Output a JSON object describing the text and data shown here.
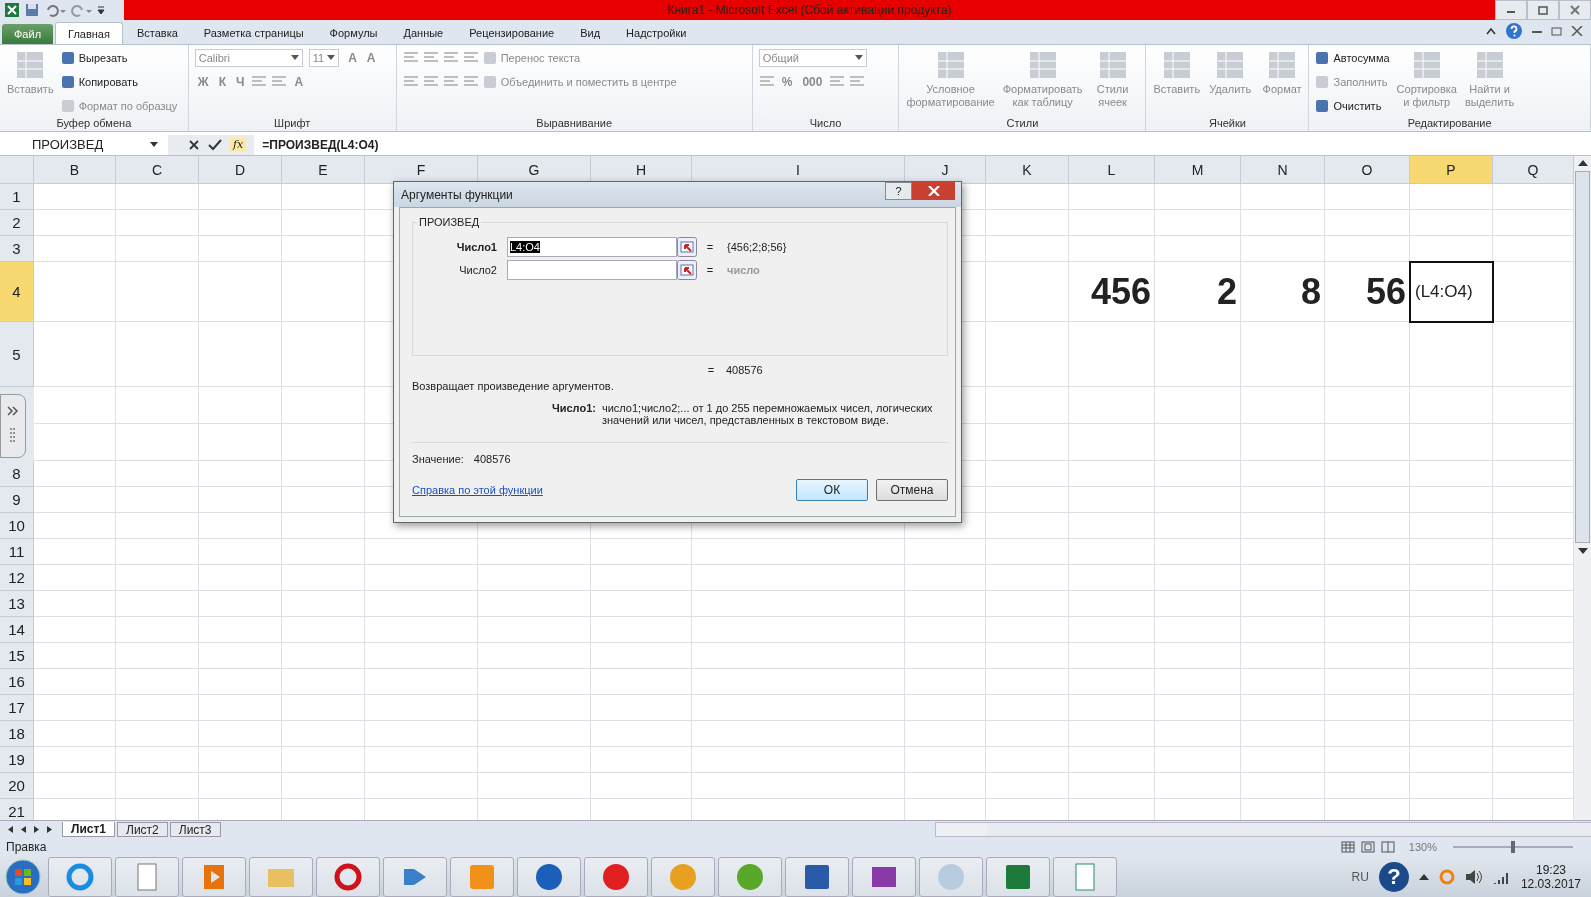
{
  "window": {
    "title": "Книга1  -  Microsoft Excel (Сбой активации продукта)"
  },
  "tabs": [
    {
      "label": "Файл",
      "kind": "file",
      "selected": false
    },
    {
      "label": "Главная",
      "kind": "tab",
      "selected": true
    },
    {
      "label": "Вставка",
      "kind": "tab",
      "selected": false
    },
    {
      "label": "Разметка страницы",
      "kind": "tab",
      "selected": false
    },
    {
      "label": "Формулы",
      "kind": "tab",
      "selected": false
    },
    {
      "label": "Данные",
      "kind": "tab",
      "selected": false
    },
    {
      "label": "Рецензирование",
      "kind": "tab",
      "selected": false
    },
    {
      "label": "Вид",
      "kind": "tab",
      "selected": false
    },
    {
      "label": "Надстройки",
      "kind": "tab",
      "selected": false
    }
  ],
  "ribbon": [
    {
      "label": "Буфер обмена",
      "parts": [
        {
          "kind": "large",
          "label": "Вставить",
          "disabled": true
        },
        {
          "kind": "stack",
          "lines": [
            [
              {
                "kind": "small",
                "label": "Вырезать",
                "disabled": false
              }
            ],
            [
              {
                "kind": "small",
                "label": "Копировать",
                "disabled": false
              }
            ],
            [
              {
                "kind": "small",
                "label": "Формат по образцу",
                "disabled": true
              }
            ]
          ]
        }
      ]
    },
    {
      "label": "Шрифт",
      "parts": [
        {
          "kind": "stack",
          "lines": [
            [
              {
                "kind": "field",
                "label": "Calibri",
                "disabled": true
              },
              {
                "kind": "field",
                "label": "11",
                "disabled": true
              },
              {
                "kind": "tool",
                "label": "A",
                "disabled": true
              },
              {
                "kind": "tool",
                "label": "A",
                "disabled": true
              }
            ],
            [
              {
                "kind": "tool",
                "label": "Ж",
                "disabled": true
              },
              {
                "kind": "tool",
                "label": "К",
                "disabled": true
              },
              {
                "kind": "tool",
                "label": "Ч",
                "disabled": true
              },
              {
                "kind": "icon",
                "disabled": true
              },
              {
                "kind": "icon",
                "disabled": true
              },
              {
                "kind": "tool",
                "label": "A",
                "disabled": true
              }
            ]
          ]
        }
      ]
    },
    {
      "label": "Выравнивание",
      "parts": [
        {
          "kind": "stack",
          "lines": [
            [
              {
                "kind": "icon",
                "disabled": true
              },
              {
                "kind": "icon",
                "disabled": true
              },
              {
                "kind": "icon",
                "disabled": true
              },
              {
                "kind": "icon",
                "disabled": true
              },
              {
                "kind": "small",
                "label": "Перенос текста",
                "disabled": true
              }
            ],
            [
              {
                "kind": "icon",
                "disabled": true
              },
              {
                "kind": "icon",
                "disabled": true
              },
              {
                "kind": "icon",
                "disabled": true
              },
              {
                "kind": "icon",
                "disabled": true
              },
              {
                "kind": "small",
                "label": "Объединить и поместить в центре",
                "disabled": true
              }
            ]
          ]
        }
      ]
    },
    {
      "label": "Число",
      "parts": [
        {
          "kind": "stack",
          "lines": [
            [
              {
                "kind": "field",
                "label": "Общий",
                "disabled": true
              }
            ],
            [
              {
                "kind": "icon",
                "disabled": true
              },
              {
                "kind": "tool",
                "label": "%",
                "disabled": true
              },
              {
                "kind": "tool",
                "label": "000",
                "disabled": true
              },
              {
                "kind": "icon",
                "disabled": true
              },
              {
                "kind": "icon",
                "disabled": true
              }
            ]
          ]
        }
      ]
    },
    {
      "label": "Стили",
      "parts": [
        {
          "kind": "large",
          "label": "Условное форматирование",
          "disabled": true
        },
        {
          "kind": "large",
          "label": "Форматировать как таблицу",
          "disabled": true
        },
        {
          "kind": "large",
          "label": "Стили ячеек",
          "disabled": true
        }
      ]
    },
    {
      "label": "Ячейки",
      "parts": [
        {
          "kind": "large",
          "label": "Вставить",
          "disabled": true
        },
        {
          "kind": "large",
          "label": "Удалить",
          "disabled": true
        },
        {
          "kind": "large",
          "label": "Формат",
          "disabled": true
        }
      ]
    },
    {
      "label": "Редактирование",
      "parts": [
        {
          "kind": "stack",
          "lines": [
            [
              {
                "kind": "small",
                "label": "Автосумма",
                "disabled": false
              }
            ],
            [
              {
                "kind": "small",
                "label": "Заполнить",
                "disabled": true
              }
            ],
            [
              {
                "kind": "small",
                "label": "Очистить",
                "disabled": false
              }
            ]
          ]
        },
        {
          "kind": "large",
          "label": "Сортировка и фильтр",
          "disabled": true
        },
        {
          "kind": "large",
          "label": "Найти и выделить",
          "disabled": true
        }
      ]
    }
  ],
  "formula_bar": {
    "name_box": "ПРОИЗВЕД",
    "fx": "fx",
    "formula": "=ПРОИЗВЕД(L4:O4)"
  },
  "columns": [
    {
      "label": "B",
      "selected": false
    },
    {
      "label": "C",
      "selected": false
    },
    {
      "label": "D",
      "selected": false
    },
    {
      "label": "E",
      "selected": false
    },
    {
      "label": "F",
      "selected": false
    },
    {
      "label": "G",
      "selected": false
    },
    {
      "label": "H",
      "selected": false
    },
    {
      "label": "I",
      "selected": false
    },
    {
      "label": "J",
      "selected": false
    },
    {
      "label": "K",
      "selected": false
    },
    {
      "label": "L",
      "selected": false
    },
    {
      "label": "M",
      "selected": false
    },
    {
      "label": "N",
      "selected": false
    },
    {
      "label": "O",
      "selected": false
    },
    {
      "label": "P",
      "selected": true
    },
    {
      "label": "Q",
      "selected": false
    }
  ],
  "rows": [
    {
      "label": "1",
      "selected": false
    },
    {
      "label": "2",
      "selected": false
    },
    {
      "label": "3",
      "selected": false
    },
    {
      "label": "4",
      "selected": true,
      "cells": [
        {
          "value": "456",
          "selected": false
        },
        {
          "value": "2",
          "selected": false
        },
        {
          "value": "8",
          "selected": false
        },
        {
          "value": "56",
          "selected": false
        },
        {
          "value": "(L4:O4)",
          "selected": true
        }
      ]
    },
    {
      "label": "5",
      "selected": false
    },
    {},
    {},
    {
      "label": "8",
      "selected": false
    },
    {
      "label": "9",
      "selected": false
    },
    {
      "label": "10",
      "selected": false
    },
    {
      "label": "11",
      "selected": false
    },
    {
      "label": "12",
      "selected": false
    },
    {
      "label": "13",
      "selected": false
    },
    {
      "label": "14",
      "selected": false
    },
    {
      "label": "15",
      "selected": false
    },
    {
      "label": "16",
      "selected": false
    },
    {
      "label": "17",
      "selected": false
    },
    {
      "label": "18",
      "selected": false
    },
    {
      "label": "19",
      "selected": false
    },
    {
      "label": "20",
      "selected": false
    },
    {
      "label": "21",
      "selected": false
    }
  ],
  "dialog": {
    "title": "Аргументы функции",
    "help": "?",
    "function_name": "ПРОИЗВЕД",
    "arguments": [
      {
        "label": "Число1",
        "value": "L4:O4",
        "active": true,
        "equals": "=",
        "result": "{456;2;8;56}"
      },
      {
        "label": "Число2",
        "active": false,
        "equals": "=",
        "result": "число"
      }
    ],
    "result_equals": "=",
    "formula_result": "408576",
    "description": "Возвращает произведение аргументов.",
    "arg_help_label": "Число1:",
    "arg_help": "число1;число2;... от 1 до 255 перемножаемых чисел, логических значений или чисел, представленных в текстовом виде.",
    "value_label": "Значение:",
    "value": "408576",
    "help_link": "Справка по этой функции",
    "buttons": [
      {
        "label": "ОК",
        "default": true
      },
      {
        "label": "Отмена",
        "default": false
      }
    ]
  },
  "sheet_tabs": [
    {
      "label": "Лист1",
      "selected": true
    },
    {
      "label": "Лист2",
      "selected": false
    },
    {
      "label": "Лист3",
      "selected": false
    }
  ],
  "status_bar": {
    "mode": "Правка",
    "zoom": "130%",
    "zoom_slider": {
      "level": 0.5
    }
  },
  "taskbar": {
    "language": "RU",
    "help": "?",
    "time": "19:23",
    "date": "12.03.2017"
  }
}
